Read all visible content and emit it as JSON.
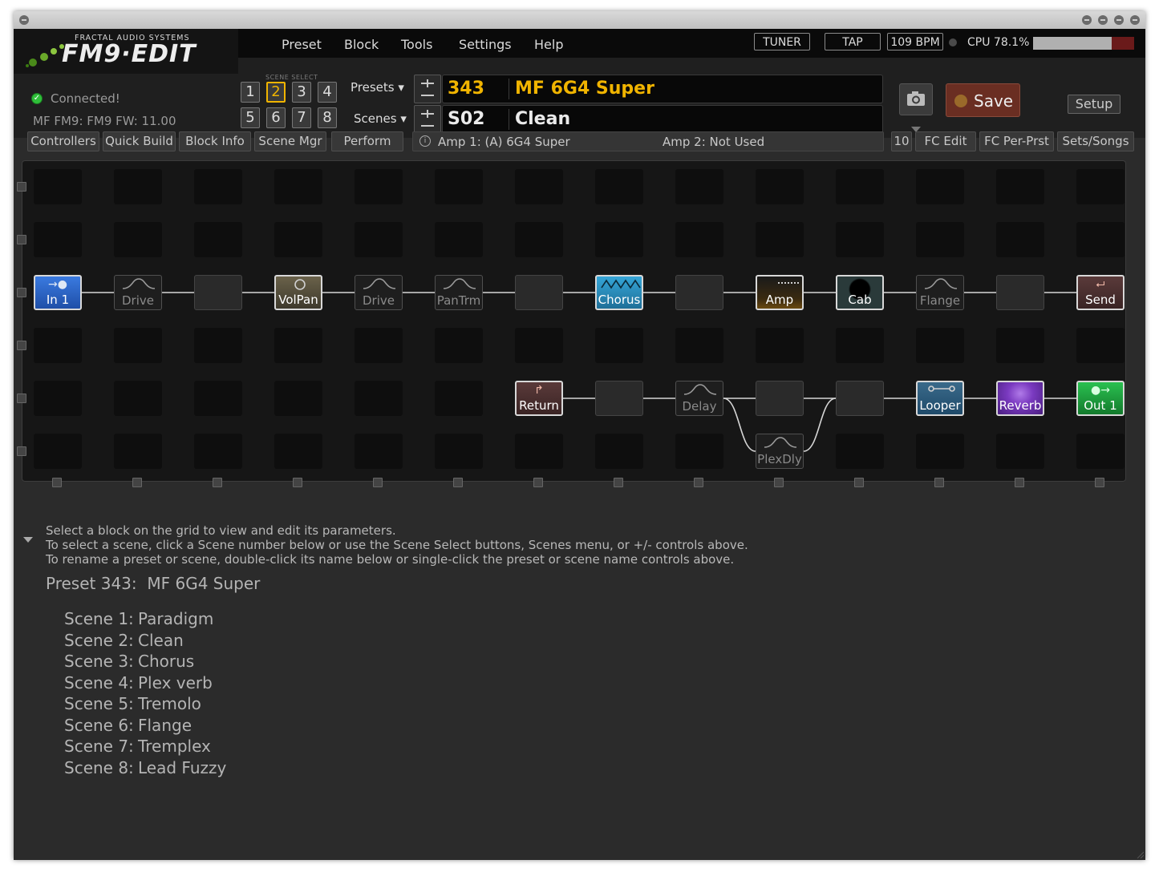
{
  "app": {
    "logo_small": "FRACTAL AUDIO SYSTEMS",
    "logo_big": "FM9·EDIT"
  },
  "menu": [
    "Preset",
    "Block",
    "Tools",
    "Settings",
    "Help"
  ],
  "header_buttons": {
    "tuner": "TUNER",
    "tap": "TAP",
    "bpm": "109 BPM",
    "cpu": "CPU 78.1%"
  },
  "cpu_percent": 78.1,
  "status": {
    "connected": "Connected!",
    "firmware": "MF FM9: FM9 FW: 11.00"
  },
  "scene_select": {
    "label": "SCENE SELECT",
    "buttons": [
      "1",
      "2",
      "3",
      "4",
      "5",
      "6",
      "7",
      "8"
    ],
    "active": "2"
  },
  "presets": {
    "label": "Presets",
    "number": "343",
    "name": "MF 6G4 Super"
  },
  "scenes": {
    "label": "Scenes",
    "number": "S02",
    "name": "Clean"
  },
  "actions": {
    "save": "Save",
    "setup": "Setup"
  },
  "toolbar": {
    "left": [
      "Controllers",
      "Quick Build",
      "Block Info",
      "Scene Mgr",
      "Perform"
    ],
    "amp1": "Amp 1: (A) 6G4 Super",
    "amp2": "Amp 2: Not Used",
    "right": [
      "10",
      "FC Edit",
      "FC Per-Prst",
      "Sets/Songs"
    ]
  },
  "grid": {
    "blocks": [
      {
        "id": "in1",
        "label": "In 1",
        "state": "on",
        "icon": "input-arrow-icon"
      },
      {
        "id": "drive1",
        "label": "Drive",
        "state": "bypassed",
        "icon": "drive-curve-icon"
      },
      {
        "id": "volpan",
        "label": "VolPan",
        "state": "on",
        "icon": "volume-knob-icon"
      },
      {
        "id": "drive2",
        "label": "Drive",
        "state": "bypassed",
        "icon": "drive-curve-icon"
      },
      {
        "id": "pantrm",
        "label": "PanTrm",
        "state": "bypassed",
        "icon": "tremolo-curve-icon"
      },
      {
        "id": "chorus",
        "label": "Chorus",
        "state": "on",
        "icon": "chorus-wave-icon"
      },
      {
        "id": "amp",
        "label": "Amp",
        "state": "on",
        "icon": "amp-icon"
      },
      {
        "id": "cab",
        "label": "Cab",
        "state": "on",
        "icon": "speaker-icon"
      },
      {
        "id": "flange",
        "label": "Flange",
        "state": "bypassed",
        "icon": "flange-curve-icon"
      },
      {
        "id": "send",
        "label": "Send",
        "state": "on",
        "icon": "send-arrow-icon"
      },
      {
        "id": "return",
        "label": "Return",
        "state": "on",
        "icon": "return-arrow-icon"
      },
      {
        "id": "delay",
        "label": "Delay",
        "state": "bypassed",
        "icon": "delay-curve-icon"
      },
      {
        "id": "plexdly",
        "label": "PlexDly",
        "state": "bypassed",
        "icon": "delay-curve-icon"
      },
      {
        "id": "looper",
        "label": "Looper",
        "state": "on",
        "icon": "cassette-icon"
      },
      {
        "id": "reverb",
        "label": "Reverb",
        "state": "on",
        "icon": "reverb-rings-icon"
      },
      {
        "id": "out1",
        "label": "Out 1",
        "state": "on",
        "icon": "output-arrow-icon"
      }
    ]
  },
  "help": [
    "Select a block on the grid to view and edit its parameters.",
    "To select a scene, click a Scene number below or use the Scene Select buttons, Scenes menu, or +/- controls above.",
    "To rename a preset or scene, double-click its name below or single-click the preset or scene name controls above."
  ],
  "preset_summary": {
    "label": "Preset 343:",
    "name": "MF 6G4 Super"
  },
  "scene_list": [
    {
      "label": "Scene 1:",
      "name": "Paradigm"
    },
    {
      "label": "Scene 2:",
      "name": "Clean"
    },
    {
      "label": "Scene 3:",
      "name": "Chorus"
    },
    {
      "label": "Scene 4:",
      "name": "Plex verb"
    },
    {
      "label": "Scene 5:",
      "name": "Tremolo"
    },
    {
      "label": "Scene 6:",
      "name": "Flange"
    },
    {
      "label": "Scene 7:",
      "name": "Tremplex"
    },
    {
      "label": "Scene 8:",
      "name": "Lead Fuzzy"
    }
  ],
  "colors": {
    "accent_yellow": "#f0b400",
    "in_block": "#2a5fc0",
    "chorus_block": "#2a8ab8",
    "reverb_block": "#7a3ac0",
    "out_block": "#1a9a3a",
    "looper_block": "#2a5a7a",
    "save_button": "#6a2e22"
  }
}
